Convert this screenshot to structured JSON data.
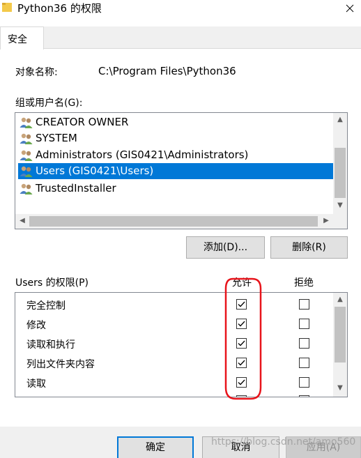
{
  "window": {
    "title": "Python36 的权限",
    "close_glyph": "×"
  },
  "tabs": [
    {
      "label": "安全",
      "selected": true
    }
  ],
  "object": {
    "label": "对象名称:",
    "value": "C:\\Program Files\\Python36"
  },
  "groups": {
    "label": "组或用户名(G):",
    "items": [
      {
        "name": "CREATOR OWNER",
        "selected": false
      },
      {
        "name": "SYSTEM",
        "selected": false
      },
      {
        "name": "Administrators (GIS0421\\Administrators)",
        "selected": false
      },
      {
        "name": "Users (GIS0421\\Users)",
        "selected": true
      },
      {
        "name": "TrustedInstaller",
        "selected": false
      }
    ]
  },
  "buttons": {
    "add": "添加(D)...",
    "remove": "删除(R)",
    "ok": "确定",
    "cancel": "取消",
    "apply": "应用(A)"
  },
  "permissions": {
    "label": "Users 的权限(P)",
    "allow_header": "允许",
    "deny_header": "拒绝",
    "rows": [
      {
        "name": "完全控制",
        "allow": true,
        "deny": false
      },
      {
        "name": "修改",
        "allow": true,
        "deny": false
      },
      {
        "name": "读取和执行",
        "allow": true,
        "deny": false
      },
      {
        "name": "列出文件夹内容",
        "allow": true,
        "deny": false
      },
      {
        "name": "读取",
        "allow": true,
        "deny": false
      }
    ]
  },
  "annotation": {
    "color": "#e8141b"
  },
  "watermark": "https://blog.csdn.net/amo560",
  "colors": {
    "selection": "#0078d7",
    "folder": "#f3c94a"
  }
}
